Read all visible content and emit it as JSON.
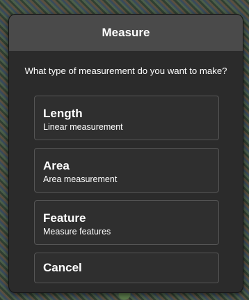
{
  "dialog": {
    "title": "Measure",
    "prompt": "What type of measurement do you want to make?",
    "options": [
      {
        "title": "Length",
        "subtitle": "Linear measurement"
      },
      {
        "title": "Area",
        "subtitle": "Area measurement"
      },
      {
        "title": "Feature",
        "subtitle": "Measure features"
      }
    ],
    "cancel_label": "Cancel"
  }
}
